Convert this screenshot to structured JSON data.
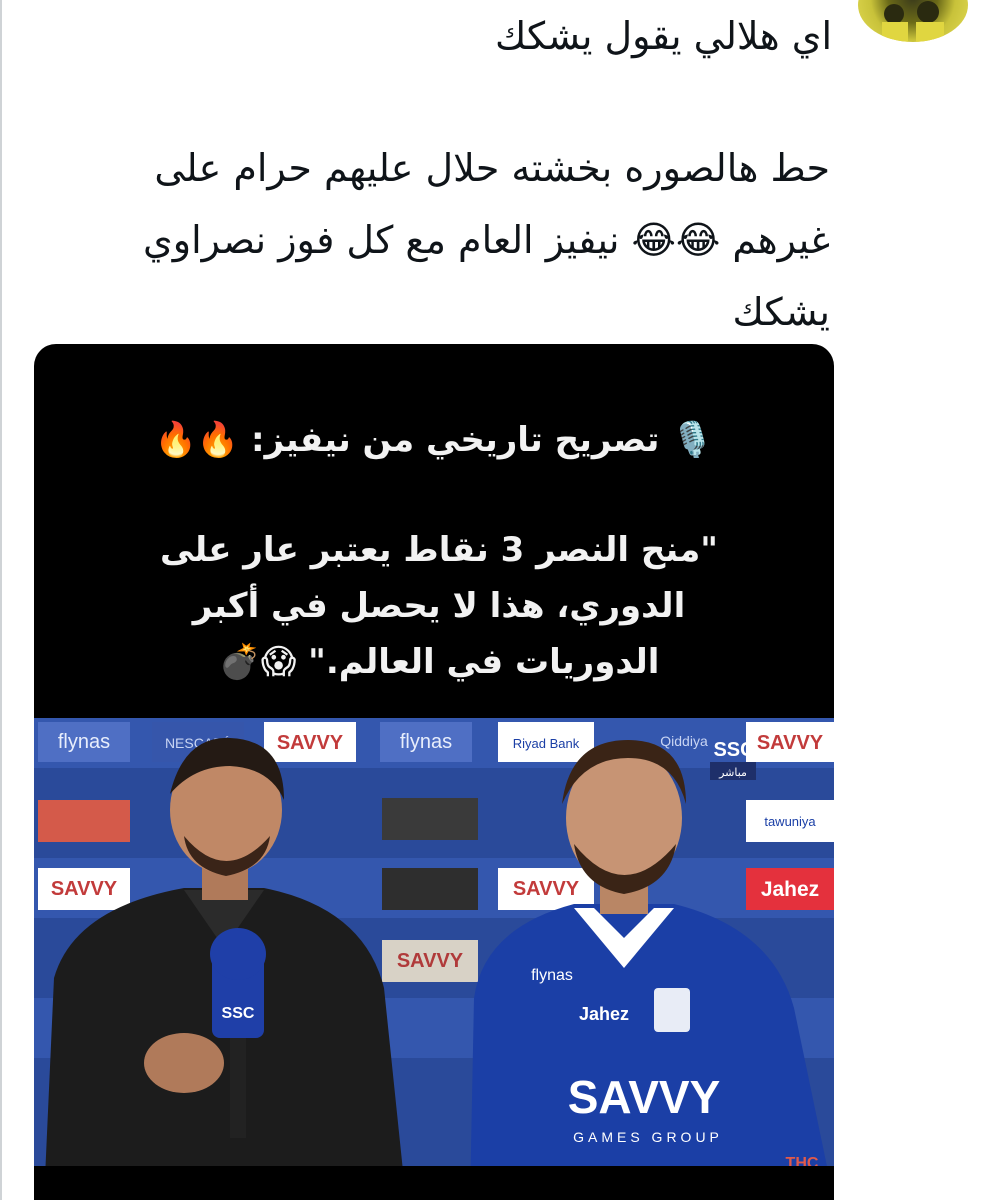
{
  "reply": {
    "text": "اي هلالي يقول يشكك"
  },
  "tweet": {
    "line1": "حط هالصوره بخشته حلال عليهم حرام على",
    "line2": "غيرهم 😂😂 نيفيز العام مع كل فوز نصراوي",
    "line3": "يشكك"
  },
  "media": {
    "title": "🎙️ تصريح تاريخي من نيفيز: 🔥🔥",
    "quote_line1": "\"منح النصر 3 نقاط يعتبر عار على",
    "quote_line2": "الدوري، هذا لا يحصل في أكبر",
    "quote_line3": "الدوريات في العالم.\" 😱💣"
  },
  "photo": {
    "sponsor_flynas": "flynas",
    "sponsor_savvy": "SAVVY",
    "sponsor_nescafe": "NESCAFÉ",
    "sponsor_jahez": "Jahez",
    "sponsor_riyad": "Riyad Bank",
    "sponsor_tawuniya": "tawuniya",
    "sponsor_qiddiya": "Qiddiya",
    "ssc_badge": "SSC",
    "ssc_live": "مباشر",
    "mic_label": "SSC",
    "jersey_flynas": "flynas",
    "jersey_jahez": "Jahez",
    "jersey_savvy": "SAVVY",
    "jersey_group": "GAMES GROUP",
    "thc": "THC"
  },
  "colors": {
    "accent_blue": "#1b3fa6",
    "backdrop_blue": "#2a4a9a",
    "text": "#0f1419"
  }
}
